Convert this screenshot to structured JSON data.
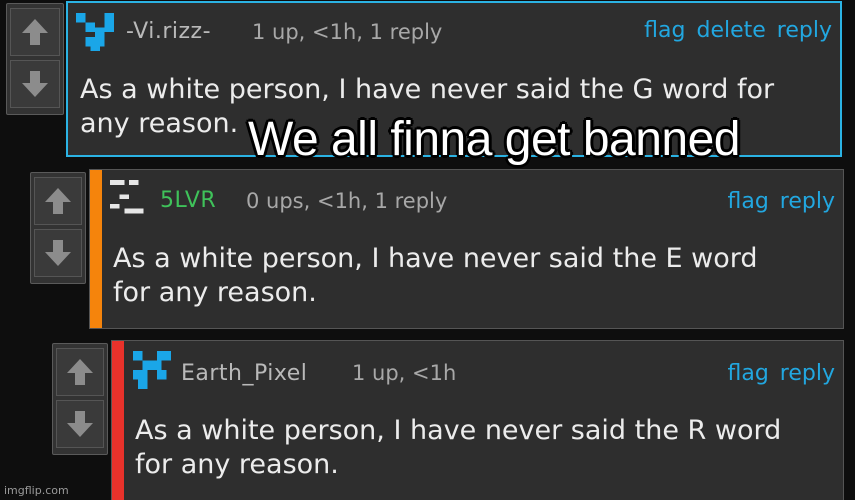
{
  "colors": {
    "link": "#22a7e0",
    "highlight_border": "#2bb3e4",
    "accent_orange": "#f5840c",
    "accent_red": "#e8322b",
    "username_green": "#3fc25a",
    "username_gray": "#b9b9b9"
  },
  "comments": [
    {
      "username": "-Vi.rizz-",
      "meta": "1 up, <1h, 1 reply",
      "actions": [
        "flag",
        "delete",
        "reply"
      ],
      "text_line1": "As a white person, I have never said the G word for",
      "text_line2": "any reason.",
      "avatar_icon": "pixel-avatar-blue-icon"
    },
    {
      "username": "5LVR",
      "meta": "0 ups, <1h, 1 reply",
      "actions": [
        "flag",
        "reply"
      ],
      "text_line1": "As a white person, I have never said the E word",
      "text_line2": "for any reason.",
      "avatar_icon": "pixel-avatar-white-icon"
    },
    {
      "username": "Earth_Pixel",
      "meta": "1 up, <1h",
      "actions": [
        "flag",
        "reply"
      ],
      "text_line1": "As a white person, I have never said the R word",
      "text_line2": "for any reason.",
      "avatar_icon": "pixel-avatar-blue-icon"
    }
  ],
  "vote_icons": {
    "up": "arrow-up-icon",
    "down": "arrow-down-icon"
  },
  "caption": "We all finna get banned",
  "watermark": "imgflip.com"
}
